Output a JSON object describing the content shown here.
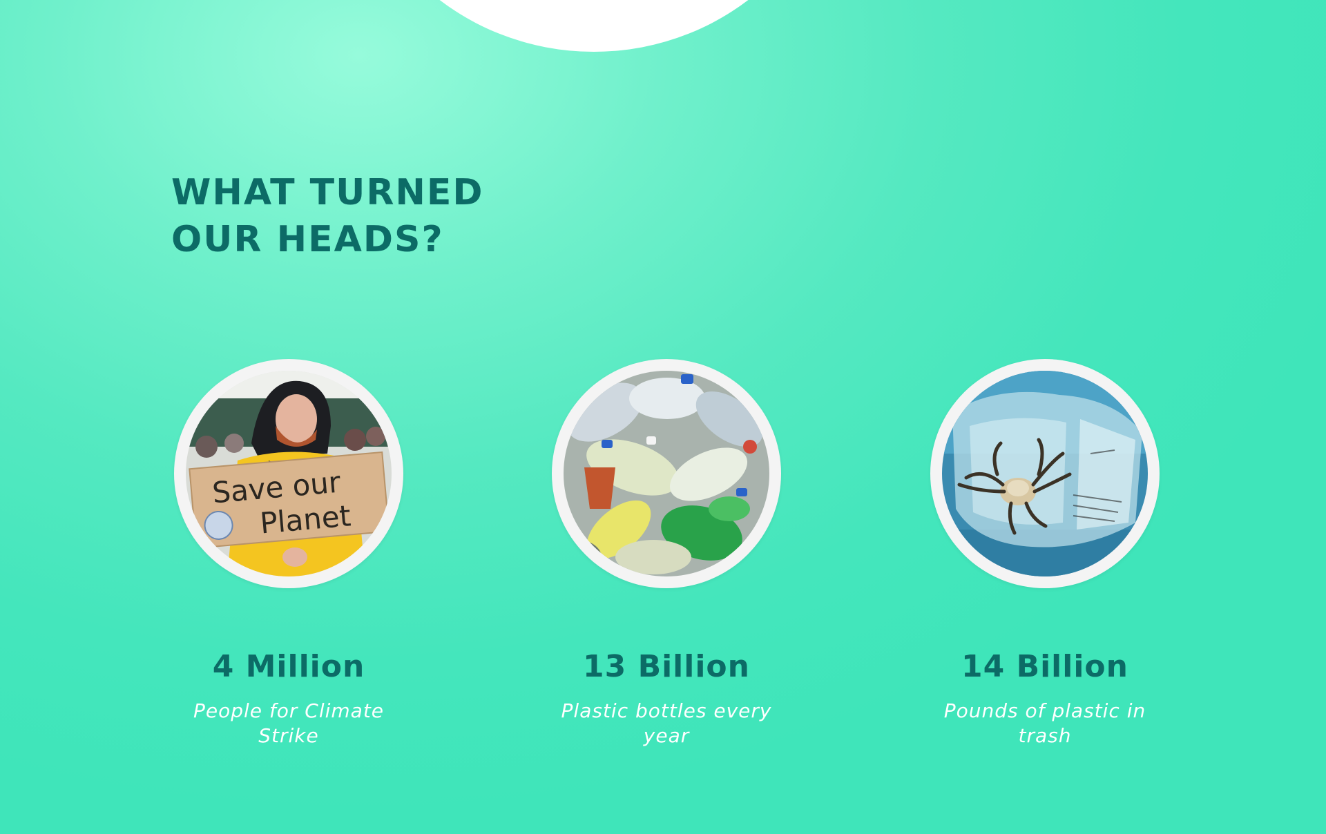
{
  "heading": {
    "line1": "WHAT TURNED",
    "line2": "OUR HEADS?"
  },
  "stats": [
    {
      "value": "4 Million",
      "label": "People for Climate Strike",
      "image_icon": "protester-photo",
      "sign_line1": "Save our",
      "sign_line2": "Planet"
    },
    {
      "value": "13 Billion",
      "label": "Plastic bottles every year",
      "image_icon": "plastic-bottles-photo"
    },
    {
      "value": "14 Billion",
      "label": "Pounds of plastic in trash",
      "image_icon": "crab-in-plastic-photo"
    }
  ],
  "colors": {
    "heading": "#0c6b66",
    "label": "#ffffff",
    "background_light": "#96fbdb",
    "background_main": "#3fe5ba",
    "circle_ring": "#f4f4f4"
  }
}
